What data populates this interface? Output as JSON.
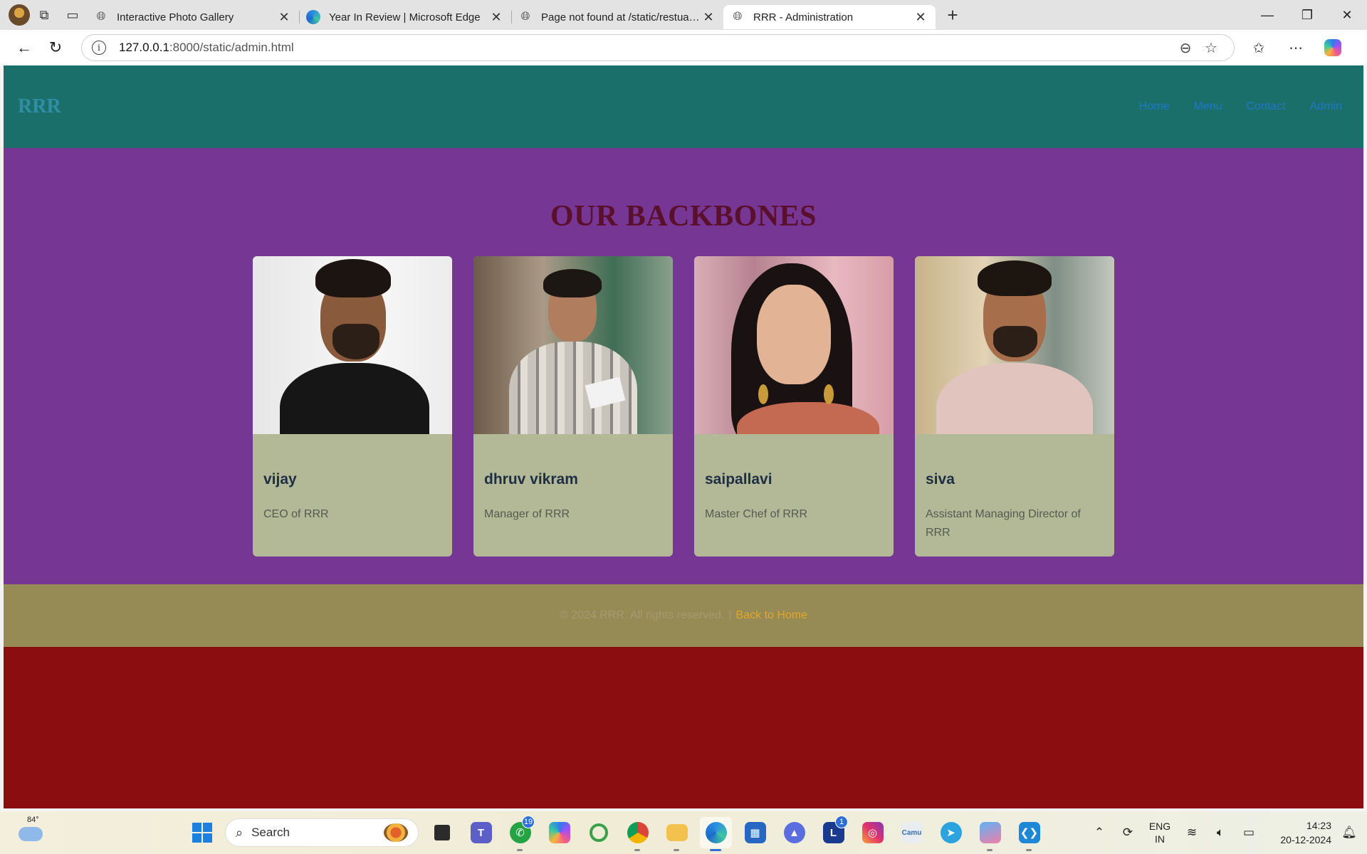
{
  "browser": {
    "tabs": [
      {
        "title": "Interactive Photo Gallery",
        "favicon": "globe-icon",
        "active": false
      },
      {
        "title": "Year In Review | Microsoft Edge",
        "favicon": "edge-icon",
        "active": false
      },
      {
        "title": "Page not found at /static/restuarant",
        "favicon": "globe-icon",
        "active": false
      },
      {
        "title": "RRR - Administration",
        "favicon": "globe-icon",
        "active": true
      }
    ],
    "url_host": "127.0.0.1",
    "url_path": ":8000/static/admin.html"
  },
  "site": {
    "logo": "RRR",
    "nav": [
      "Home",
      "Menu",
      "Contact",
      "Admin"
    ],
    "section_title": "OUR BACKBONES",
    "team": [
      {
        "name": "vijay",
        "role": "CEO of RRR"
      },
      {
        "name": "dhruv vikram",
        "role": "Manager of RRR"
      },
      {
        "name": "saipallavi",
        "role": "Master Chef of RRR"
      },
      {
        "name": "siva",
        "role": "Assistant Managing Director of RRR"
      }
    ],
    "footer_copy": "© 2024 RRR. All rights reserved.",
    "footer_sep": "|",
    "footer_link": "Back to Home",
    "colors": {
      "header": "#1b6f6a",
      "section": "#763694",
      "card": "#b3b897",
      "footer": "#968a55",
      "page": "#8b0d0f"
    }
  },
  "taskbar": {
    "weather_temp": "84°",
    "search_placeholder": "Search",
    "whatsapp_badge": "19",
    "l_badge": "1",
    "lang_line1": "ENG",
    "lang_line2": "IN",
    "time": "14:23",
    "date": "20-12-2024"
  }
}
